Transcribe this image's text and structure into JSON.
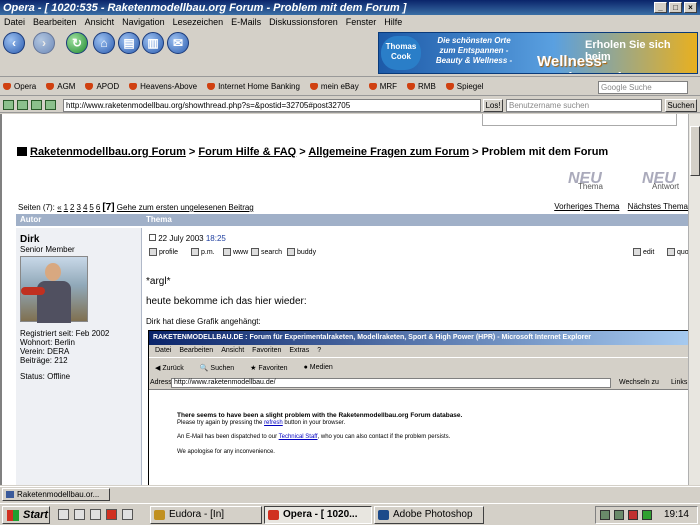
{
  "window": {
    "title": "Opera - [ 1020:535 - Raketenmodellbau.org Forum - Problem mit dem Forum ]"
  },
  "menu": [
    "Datei",
    "Bearbeiten",
    "Ansicht",
    "Navigation",
    "Lesezeichen",
    "E-Mails",
    "Diskussionsforen",
    "Fenster",
    "Hilfe"
  ],
  "ad": {
    "brand": "Thomas Cook",
    "tagline": "Die schönsten Orte zum Entspannen - Beauty & Wellness -",
    "headline1": "Erholen Sie sich beim",
    "headline2": "Wellness-Wochenende"
  },
  "bookmarks": [
    "Opera",
    "AGM",
    "APOD",
    "Heavens-Above",
    "Internet Home Banking",
    "mein eBay",
    "MRF",
    "RMB",
    "Spiegel"
  ],
  "google_search": {
    "placeholder": "Google Suche"
  },
  "address": {
    "url": "http://www.raketenmodellbau.org/showthread.php?s=&postid=32705#post32705",
    "go_label": "Los!",
    "search_placeholder": "Benutzername suchen",
    "search_label": "Suchen"
  },
  "breadcrumb": {
    "forum": "Raketenmodellbau.org Forum",
    "sep": ">",
    "cat": "Forum Hilfe & FAQ",
    "sub": "Allgemeine Fragen zum Forum",
    "current": "Problem mit dem Forum"
  },
  "newbuttons": {
    "thema": "Thema",
    "antwort": "Antwort",
    "new": "NEU"
  },
  "pagination": {
    "label": "Seiten (7):",
    "first": "«",
    "pages": [
      "1",
      "2",
      "3",
      "4",
      "5",
      "6"
    ],
    "current": "[7]",
    "first_unread": "Gehe zum ersten ungelesenen Beitrag"
  },
  "threadnav": {
    "prev": "Vorheriges Thema",
    "next": "Nächstes Thema"
  },
  "table": {
    "col_author": "Autor",
    "col_topic": "Thema"
  },
  "post": {
    "author": "Dirk",
    "rank": "Senior Member",
    "registered": "Registriert seit: Feb 2002",
    "location": "Wohnort: Berlin",
    "club": "Verein: DERA",
    "posts": "Beiträge: 212",
    "status": "Status: Offline",
    "date": "22 July 2003",
    "time": "18:25",
    "tools": [
      "profile",
      "p.m.",
      "www",
      "search",
      "buddy"
    ],
    "edit": "edit",
    "quote": "quo",
    "line1": "*argl*",
    "line2": "heute bekomme ich das hier wieder:",
    "attachment_label": "Dirk hat diese Grafik angehängt:"
  },
  "embedded": {
    "title": "RAKETENMODELLBAU.DE : Forum für Experimentalraketen, Modellraketen, Sport & High Power (HPR) - Microsoft Internet Explorer",
    "menu": [
      "Datei",
      "Bearbeiten",
      "Ansicht",
      "Favoriten",
      "Extras",
      "?"
    ],
    "tools": [
      "Zurück",
      "Suchen",
      "Favoriten",
      "Medien"
    ],
    "address_label": "Adresse",
    "address": "http://www.raketenmodellbau.de/",
    "go": "Wechseln zu",
    "links": "Links",
    "err1": "There seems to have been a slight problem with the Raketenmodellbau.org Forum database.",
    "err2a": "Please try again by pressing the ",
    "err2b": "refresh",
    "err2c": " button in your browser.",
    "err3a": "An E-Mail has been dispatched to our ",
    "err3b": "Technical Staff",
    "err3c": ", who you can also contact if the problem persists.",
    "err4": "We apologise for any inconvenience."
  },
  "tab": {
    "label": "Raketenmodellbau.or..."
  },
  "taskbar": {
    "start": "Start",
    "tasks": [
      "Eudora - [In]",
      "Opera - [ 1020...",
      "Adobe Photoshop"
    ],
    "clock": "19:14"
  }
}
